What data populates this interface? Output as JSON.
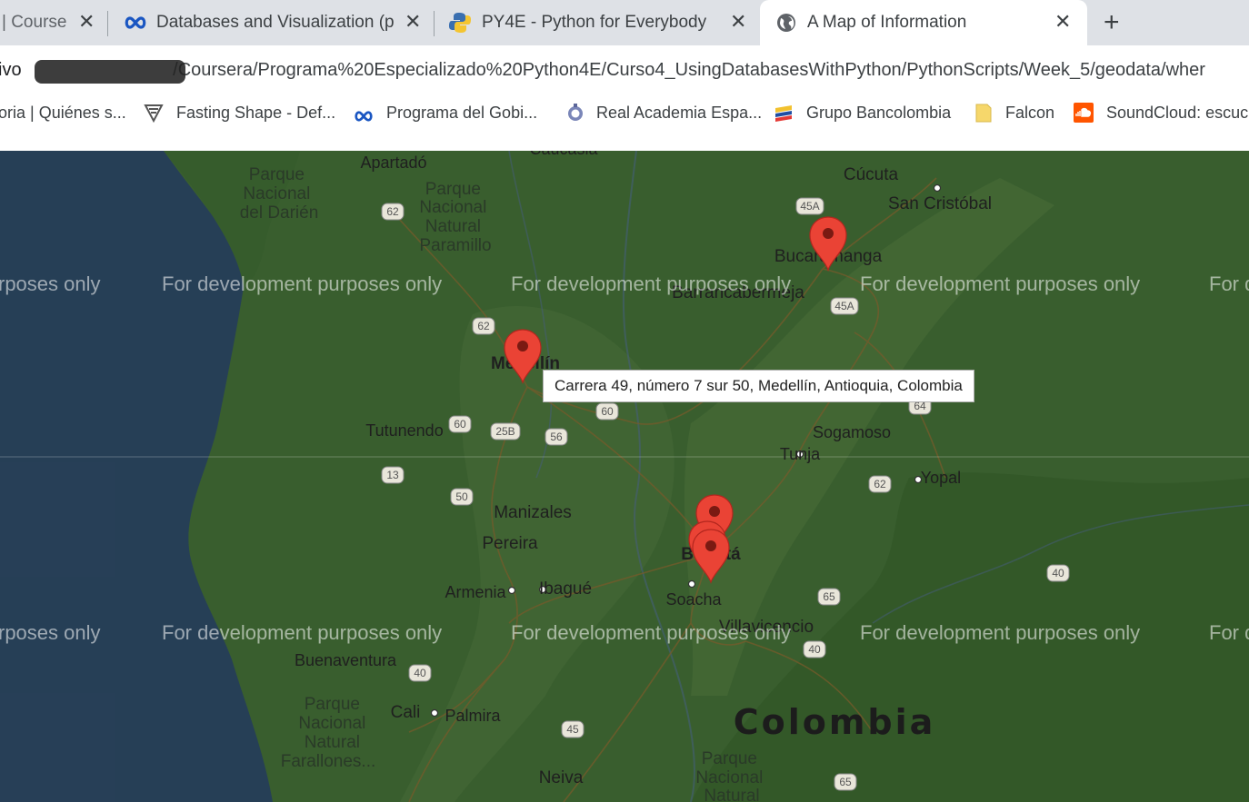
{
  "tabs": [
    {
      "title": "| Courser",
      "active": false
    },
    {
      "title": "Databases and Visualization (pee",
      "active": false
    },
    {
      "title": "PY4E - Python for Everybody",
      "active": false
    },
    {
      "title": "A Map of Information",
      "active": true
    }
  ],
  "address_bar": {
    "prefix": "ivo",
    "url": "/Coursera/Programa%20Especializado%20Python4E/Curso4_UsingDatabasesWithPython/PythonScripts/Week_5/geodata/wher"
  },
  "bookmarks": [
    {
      "label": "oria | Quiénes s...",
      "icon": "page-icon"
    },
    {
      "label": "Fasting Shape - Def...",
      "icon": "shape-logo-icon"
    },
    {
      "label": "Programa del Gobi...",
      "icon": "infinity-icon"
    },
    {
      "label": "Real Academia Espa...",
      "icon": "rae-seal-icon"
    },
    {
      "label": "Grupo Bancolombia",
      "icon": "bancolombia-icon"
    },
    {
      "label": "Falcon",
      "icon": "folder-icon"
    },
    {
      "label": "SoundCloud: escuc...",
      "icon": "soundcloud-icon"
    }
  ],
  "map": {
    "watermark": "For development purposes only",
    "watermark_left_partial": "rposes only",
    "watermark_right_partial": "For d",
    "country_label": "Colombia",
    "cities": {
      "apartado": "Apartadó",
      "cucuta": "Cúcuta",
      "san_cristobal": "San Cristóbal",
      "bucaramanga": "Bucaramanga",
      "barrancabermeja": "Barrancabermeja",
      "medellin": "Medellín",
      "tutunendo": "Tutunendo",
      "sogamoso": "Sogamoso",
      "tunja": "Tunja",
      "yopal": "Yopal",
      "manizales": "Manizales",
      "pereira": "Pereira",
      "armenia": "Armenia",
      "ibague": "Ibagué",
      "bogota": "Bogotá",
      "soacha": "Soacha",
      "villavicencio": "Villavicencio",
      "buenaventura": "Buenaventura",
      "cali": "Cali",
      "palmira": "Palmira",
      "neiva": "Neiva",
      "caucasia": "Caucasia"
    },
    "parks": {
      "darien": [
        "Parque",
        "Nacional",
        "del Darién"
      ],
      "paramillo": [
        "Parque",
        "Nacional",
        "Natural",
        "Paramillo"
      ],
      "farallones": [
        "Parque",
        "Nacional",
        "Natural",
        "Farallones..."
      ],
      "south": [
        "Parque",
        "Nacional",
        "Natural"
      ]
    },
    "shields": [
      "62",
      "45A",
      "62",
      "45A",
      "60",
      "25B",
      "60",
      "56",
      "64",
      "13",
      "50",
      "62",
      "40",
      "65",
      "40",
      "40",
      "45",
      "65"
    ],
    "tooltip": "Carrera 49, número 7 sur 50, Medellín, Antioquia, Colombia",
    "colors": {
      "ocean": "#345575",
      "land": "#4c7d3e",
      "overlay": "rgba(0,0,0,0.28)",
      "marker": "#ea4335"
    }
  }
}
